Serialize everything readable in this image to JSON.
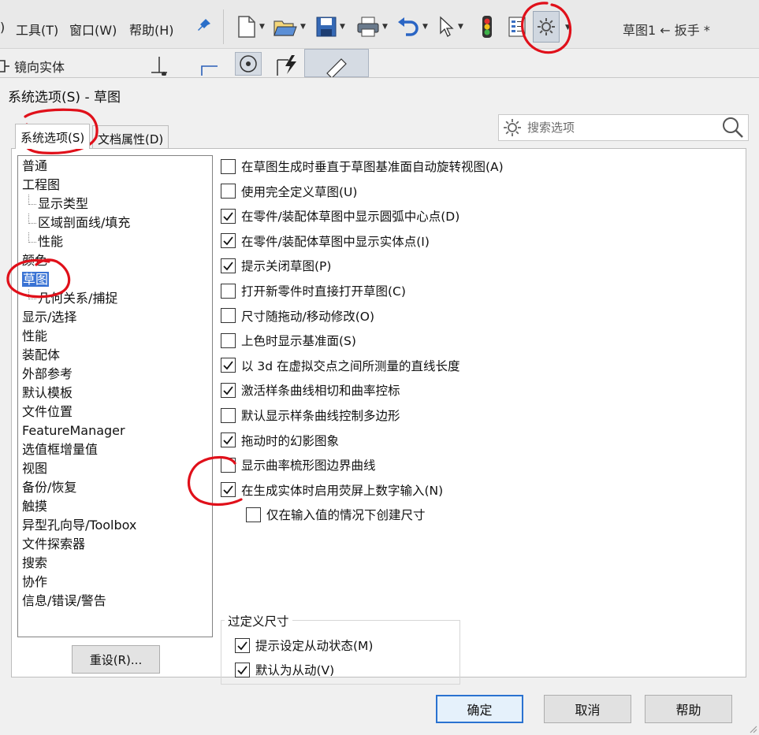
{
  "menubar": {
    "items": [
      "工具(T)",
      "窗口(W)",
      "帮助(H)"
    ],
    "left_fragment": ")",
    "doc_title": "草图1 ← 扳手 *",
    "icons": [
      "pin-icon",
      "new-document-icon",
      "open-folder-icon",
      "save-icon",
      "print-icon",
      "undo-icon",
      "select-arrow-icon",
      "traffic-light-icon",
      "layers-icon",
      "options-gear-icon"
    ]
  },
  "subbar": {
    "mirror_label": "镜向实体"
  },
  "dialog": {
    "title": "系统选项(S) - 草图",
    "tabs": [
      "系统选项(S)",
      "文档属性(D)"
    ],
    "search_placeholder": "搜索选项",
    "tree": [
      {
        "label": "普通",
        "level": 0
      },
      {
        "label": "工程图",
        "level": 0
      },
      {
        "label": "显示类型",
        "level": 1
      },
      {
        "label": "区域剖面线/填充",
        "level": 1
      },
      {
        "label": "性能",
        "level": 1
      },
      {
        "label": "颜色",
        "level": 0
      },
      {
        "label": "草图",
        "level": 0,
        "selected": true
      },
      {
        "label": "几何关系/捕捉",
        "level": 1
      },
      {
        "label": "显示/选择",
        "level": 0
      },
      {
        "label": "性能",
        "level": 0
      },
      {
        "label": "装配体",
        "level": 0
      },
      {
        "label": "外部参考",
        "level": 0
      },
      {
        "label": "默认模板",
        "level": 0
      },
      {
        "label": "文件位置",
        "level": 0
      },
      {
        "label": "FeatureManager",
        "level": 0
      },
      {
        "label": "选值框增量值",
        "level": 0
      },
      {
        "label": "视图",
        "level": 0
      },
      {
        "label": "备份/恢复",
        "level": 0
      },
      {
        "label": "触摸",
        "level": 0
      },
      {
        "label": "异型孔向导/Toolbox",
        "level": 0
      },
      {
        "label": "文件探索器",
        "level": 0
      },
      {
        "label": "搜索",
        "level": 0
      },
      {
        "label": "协作",
        "level": 0
      },
      {
        "label": "信息/错误/警告",
        "level": 0
      }
    ],
    "reset_label": "重设(R)...",
    "options": [
      {
        "label": "在草图生成时垂直于草图基准面自动旋转视图(A)",
        "checked": false
      },
      {
        "label": "使用完全定义草图(U)",
        "checked": false
      },
      {
        "label": "在零件/装配体草图中显示圆弧中心点(D)",
        "checked": true
      },
      {
        "label": "在零件/装配体草图中显示实体点(I)",
        "checked": true
      },
      {
        "label": "提示关闭草图(P)",
        "checked": true
      },
      {
        "label": "打开新零件时直接打开草图(C)",
        "checked": false
      },
      {
        "label": "尺寸随拖动/移动修改(O)",
        "checked": false
      },
      {
        "label": "上色时显示基准面(S)",
        "checked": false
      },
      {
        "label": "以 3d 在虚拟交点之间所测量的直线长度",
        "checked": true
      },
      {
        "label": "激活样条曲线相切和曲率控标",
        "checked": true
      },
      {
        "label": "默认显示样条曲线控制多边形",
        "checked": false
      },
      {
        "label": "拖动时的幻影图象",
        "checked": true
      },
      {
        "label": "显示曲率梳形图边界曲线",
        "checked": false
      },
      {
        "label": "在生成实体时启用荧屏上数字输入(N)",
        "checked": true
      },
      {
        "label": "仅在输入值的情况下创建尺寸",
        "checked": false,
        "indent": true
      }
    ],
    "over_define": {
      "title": "过定义尺寸",
      "options": [
        {
          "label": "提示设定从动状态(M)",
          "checked": true
        },
        {
          "label": "默认为从动(V)",
          "checked": true
        }
      ]
    },
    "buttons": {
      "ok": "确定",
      "cancel": "取消",
      "help": "帮助"
    }
  },
  "colors": {
    "selection": "#3a73d4",
    "annotation": "#e0101a",
    "default_button_border": "#2a72d0"
  }
}
